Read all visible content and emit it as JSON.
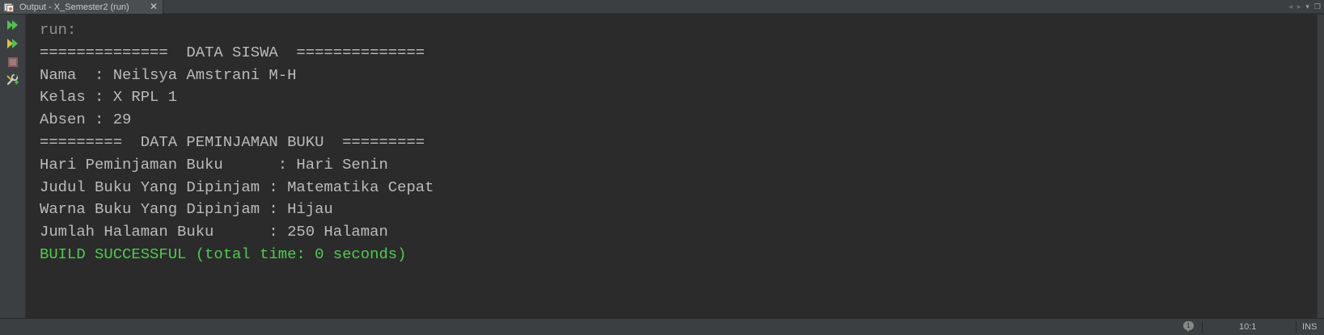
{
  "tab": {
    "title": "Output - X_Semester2 (run)",
    "close_glyph": "✕",
    "icon": "output-window-icon"
  },
  "window_controls": {
    "prev_glyph": "◂",
    "next_glyph": "▸",
    "menu_glyph": "▾",
    "restore_glyph": "❐"
  },
  "toolbar": {
    "buttons": [
      {
        "name": "rerun-icon",
        "tooltip": ""
      },
      {
        "name": "rerun-with-params-icon",
        "tooltip": ""
      },
      {
        "name": "stop-icon",
        "tooltip": ""
      },
      {
        "name": "settings-wrench-icon",
        "tooltip": ""
      }
    ],
    "colors": {
      "green": "#4fc34f",
      "stop_disabled": "#a46a6a"
    }
  },
  "console": {
    "lines": [
      {
        "text": "run:",
        "style": "muted"
      },
      {
        "text": "==============  DATA SISWA  ==============",
        "style": "normal"
      },
      {
        "text": "Nama  : Neilsya Amstrani M-H",
        "style": "normal"
      },
      {
        "text": "Kelas : X RPL 1",
        "style": "normal"
      },
      {
        "text": "Absen : 29",
        "style": "normal"
      },
      {
        "text": "=========  DATA PEMINJAMAN BUKU  =========",
        "style": "normal"
      },
      {
        "text": "Hari Peminjaman Buku      : Hari Senin",
        "style": "normal"
      },
      {
        "text": "Judul Buku Yang Dipinjam : Matematika Cepat",
        "style": "normal"
      },
      {
        "text": "Warna Buku Yang Dipinjam : Hijau",
        "style": "normal"
      },
      {
        "text": "Jumlah Halaman Buku      : 250 Halaman",
        "style": "normal"
      },
      {
        "text": "BUILD SUCCESSFUL (total time: 0 seconds)",
        "style": "success"
      }
    ],
    "colors": {
      "text": "#bbbbbb",
      "muted": "#8f8f8f",
      "success": "#4fcb4f",
      "background": "#2b2b2b"
    }
  },
  "statusbar": {
    "notification_count": "1",
    "caret_position": "10:1",
    "insert_mode": "INS"
  }
}
